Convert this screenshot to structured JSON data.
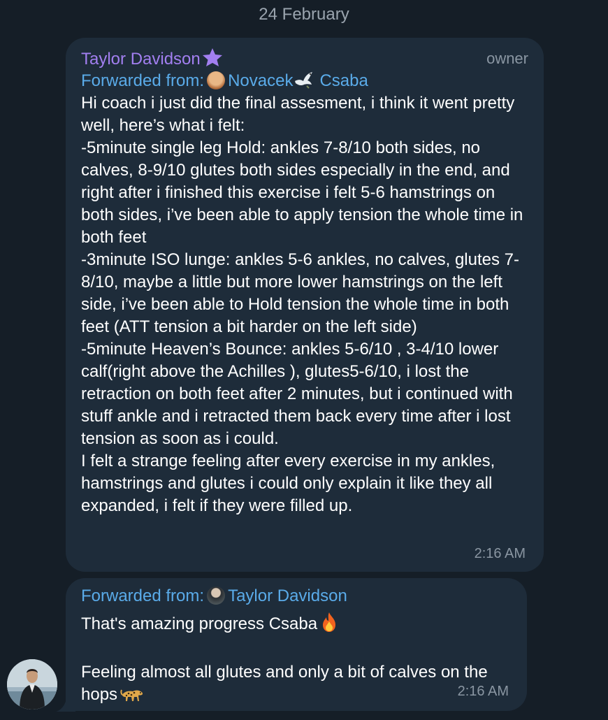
{
  "date_separator": "24 February",
  "messages": [
    {
      "sender": "Taylor Davidson",
      "role": "owner",
      "forwarded_label": "Forwarded from:",
      "forwarded_name_1": "Novacek",
      "forwarded_name_2": "Csaba",
      "text": "Hi coach i just did the final assesment, i think it went pretty well, here’s what i felt:\n-5minute single leg Hold: ankles 7-8/10 both sides, no calves, 8-9/10 glutes both sides especially in the end, and right after i finished this exercise i felt 5-6 hamstrings on both sides, i’ve been able to apply tension the whole time in both feet\n-3minute ISO lunge: ankles 5-6 ankles, no calves, glutes 7-8/10, maybe a little but more lower hamstrings on the left side, i’ve been able to Hold tension the whole time in both feet (ATT tension a bit harder on the left side)\n-5minute Heaven’s Bounce: ankles 5-6/10 , 3-4/10 lower calf(right above the Achilles ), glutes5-6/10, i lost the retraction on both feet after 2 minutes, but i continued with stuff ankle and i retracted them back every time after i lost tension as soon as i could.\nI felt a strange feeling after every exercise in my ankles, hamstrings and glutes i could only explain it like they all expanded, i felt if they were filled up.",
      "time": "2:16 AM"
    },
    {
      "forwarded_label": "Forwarded from:",
      "forwarded_name": "Taylor Davidson",
      "line1": "That's amazing progress Csaba",
      "line2": "Feeling almost all glutes and only a bit of calves on the hops",
      "time": "2:16 AM"
    }
  ],
  "colors": {
    "background": "#151e27",
    "bubble": "#1e2c3a",
    "sender": "#a27ff0",
    "link": "#5aabe9",
    "meta": "#8a96a2"
  },
  "icons": [
    "star-icon",
    "dove-icon",
    "fire-emoji",
    "leopard-emoji"
  ]
}
